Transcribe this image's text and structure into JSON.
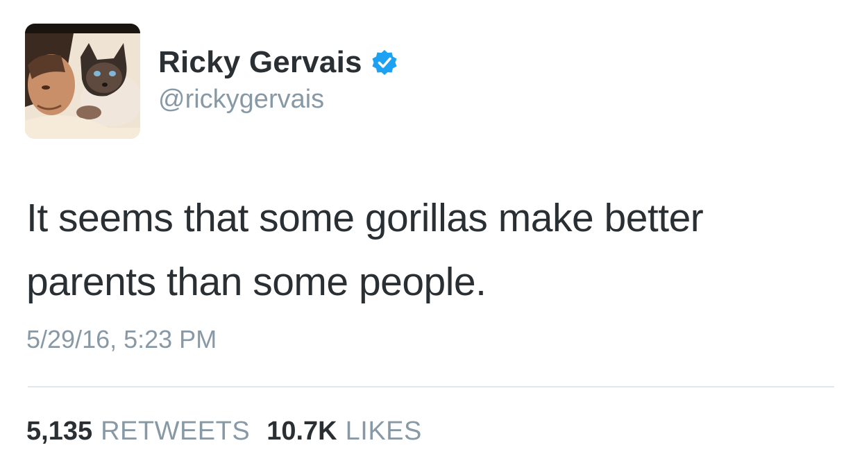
{
  "tweet": {
    "author": {
      "display_name": "Ricky Gervais",
      "handle": "@rickygervais",
      "verified": true,
      "avatar_description": "profile photo of man with cat"
    },
    "text_line_1": "It seems that some gorillas make better",
    "text_line_2": "parents than some people.",
    "timestamp": "5/29/16, 5:23 PM",
    "stats": {
      "retweets_count": "5,135",
      "retweets_label": "RETWEETS",
      "likes_count": "10.7K",
      "likes_label": "LIKES"
    }
  },
  "colors": {
    "text_primary": "#292f33",
    "text_secondary": "#8899a6",
    "verified_blue": "#1da1f2",
    "divider": "#e1e8ed"
  },
  "icons": {
    "verified": "verified-badge-icon"
  }
}
